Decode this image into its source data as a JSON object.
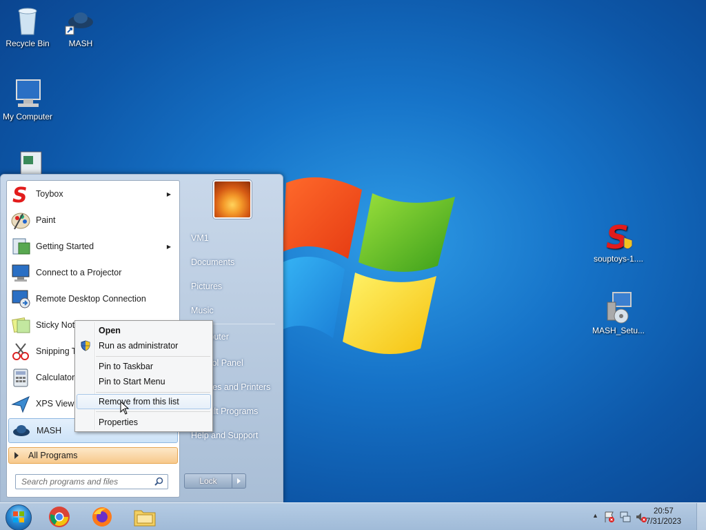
{
  "desktop": {
    "icons": [
      {
        "label": "Recycle Bin",
        "icon": "recycle-bin-icon"
      },
      {
        "label": "MASH",
        "icon": "mash-icon"
      },
      {
        "label": "My Computer",
        "icon": "computer-icon"
      },
      {
        "label": "souptoys-1....",
        "icon": "souptoys-installer-icon"
      },
      {
        "label": "MASH_Setu...",
        "icon": "mash-setup-icon"
      }
    ]
  },
  "start_menu": {
    "programs": [
      {
        "label": "Toybox",
        "submenu": true
      },
      {
        "label": "Paint",
        "submenu": false
      },
      {
        "label": "Getting Started",
        "submenu": true
      },
      {
        "label": "Connect to a Projector",
        "submenu": false
      },
      {
        "label": "Remote Desktop Connection",
        "submenu": false
      },
      {
        "label": "Sticky Notes",
        "submenu": false
      },
      {
        "label": "Snipping Tool",
        "submenu": false
      },
      {
        "label": "Calculator",
        "submenu": false
      },
      {
        "label": "XPS Viewer",
        "submenu": false
      },
      {
        "label": "MASH",
        "submenu": false
      }
    ],
    "all_programs": "All Programs",
    "search_placeholder": "Search programs and files",
    "right_items": [
      "VM1",
      "Documents",
      "Pictures",
      "Music",
      "Computer",
      "Control Panel",
      "Devices and Printers",
      "Default Programs",
      "Help and Support"
    ],
    "lock_label": "Lock"
  },
  "context_menu": {
    "items": [
      "Open",
      "Run as administrator",
      "Pin to Taskbar",
      "Pin to Start Menu",
      "Remove from this list",
      "Properties"
    ]
  },
  "taskbar": {
    "apps": [
      "chrome-icon",
      "firefox-icon",
      "explorer-icon"
    ],
    "time": "20:57",
    "date": "7/31/2023"
  }
}
